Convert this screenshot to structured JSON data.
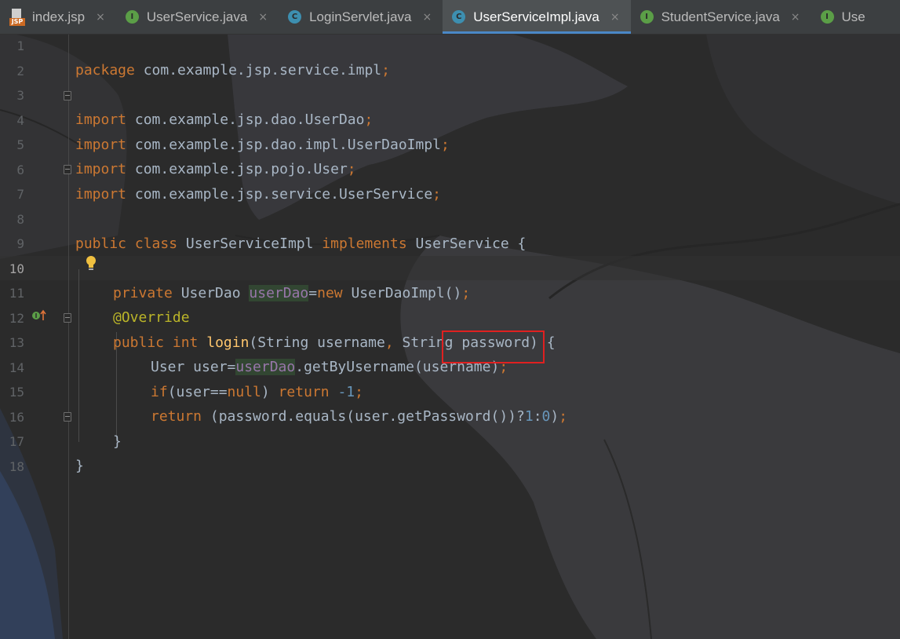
{
  "tabs": [
    {
      "label": "index.jsp",
      "icon": "jsp-file-icon",
      "icon_text": "JSP",
      "active": false,
      "close": "×"
    },
    {
      "label": "UserService.java",
      "icon": "interface-icon",
      "icon_text": "I",
      "active": false,
      "close": "×"
    },
    {
      "label": "LoginServlet.java",
      "icon": "class-icon",
      "icon_text": "C",
      "active": false,
      "close": "×"
    },
    {
      "label": "UserServiceImpl.java",
      "icon": "class-icon",
      "icon_text": "C",
      "active": true,
      "close": "×"
    },
    {
      "label": "StudentService.java",
      "icon": "interface-icon",
      "icon_text": "I",
      "active": false,
      "close": "×"
    },
    {
      "label": "Use",
      "icon": "interface-icon",
      "icon_text": "I",
      "active": false,
      "close": ""
    }
  ],
  "editor": {
    "current_line": 10,
    "lines": [
      {
        "n": "1"
      },
      {
        "n": "2"
      },
      {
        "n": "3"
      },
      {
        "n": "4"
      },
      {
        "n": "5"
      },
      {
        "n": "6"
      },
      {
        "n": "7"
      },
      {
        "n": "8"
      },
      {
        "n": "9"
      },
      {
        "n": "10"
      },
      {
        "n": "11"
      },
      {
        "n": "12"
      },
      {
        "n": "13"
      },
      {
        "n": "14"
      },
      {
        "n": "15"
      },
      {
        "n": "16"
      },
      {
        "n": "17"
      },
      {
        "n": "18"
      }
    ],
    "tokens": {
      "l1": [
        "package",
        " com.example.jsp.service.impl",
        ";"
      ],
      "l3": [
        "import",
        " com.example.jsp.dao.UserDao",
        ";"
      ],
      "l4": [
        "import",
        " com.example.jsp.dao.impl.UserDaoImpl",
        ";"
      ],
      "l5": [
        "import",
        " com.example.jsp.pojo.User",
        ";"
      ],
      "l6": [
        "import",
        " com.example.jsp.service.UserService",
        ";"
      ],
      "l8": [
        "public",
        " ",
        "class",
        " UserServiceImpl ",
        "implements",
        " UserService {"
      ],
      "l10": [
        "private",
        " UserDao ",
        "userDao",
        "=",
        "new",
        " UserDaoImpl()",
        ";"
      ],
      "l11": [
        "@Override"
      ],
      "l12": [
        "public",
        " ",
        "int",
        " ",
        "login",
        "(String username",
        ",",
        " String password) {"
      ],
      "l13": [
        "User user=",
        "userDao",
        ".getByUsername(username)",
        ";"
      ],
      "l14": [
        "if",
        "(user==",
        "null",
        ") ",
        "return",
        " ",
        "-1",
        ";"
      ],
      "l15": [
        "return",
        " (password.equals(user.getPassword())?",
        "1",
        ":",
        "0",
        ")",
        ";"
      ],
      "l16": [
        "}"
      ],
      "l17": [
        "}"
      ]
    }
  },
  "colors": {
    "background": "#2b2b2b",
    "keyword": "#cc7832",
    "annotation": "#bbb529",
    "number": "#6897bb",
    "field": "#9876aa",
    "method": "#ffc66d",
    "default_text": "#a9b7c6",
    "highlight_box": "#e02020",
    "active_tab_underline": "#4a88c7"
  },
  "icons": {
    "intention": "lightbulb-icon",
    "gutter_impl": "implements-method-icon"
  }
}
